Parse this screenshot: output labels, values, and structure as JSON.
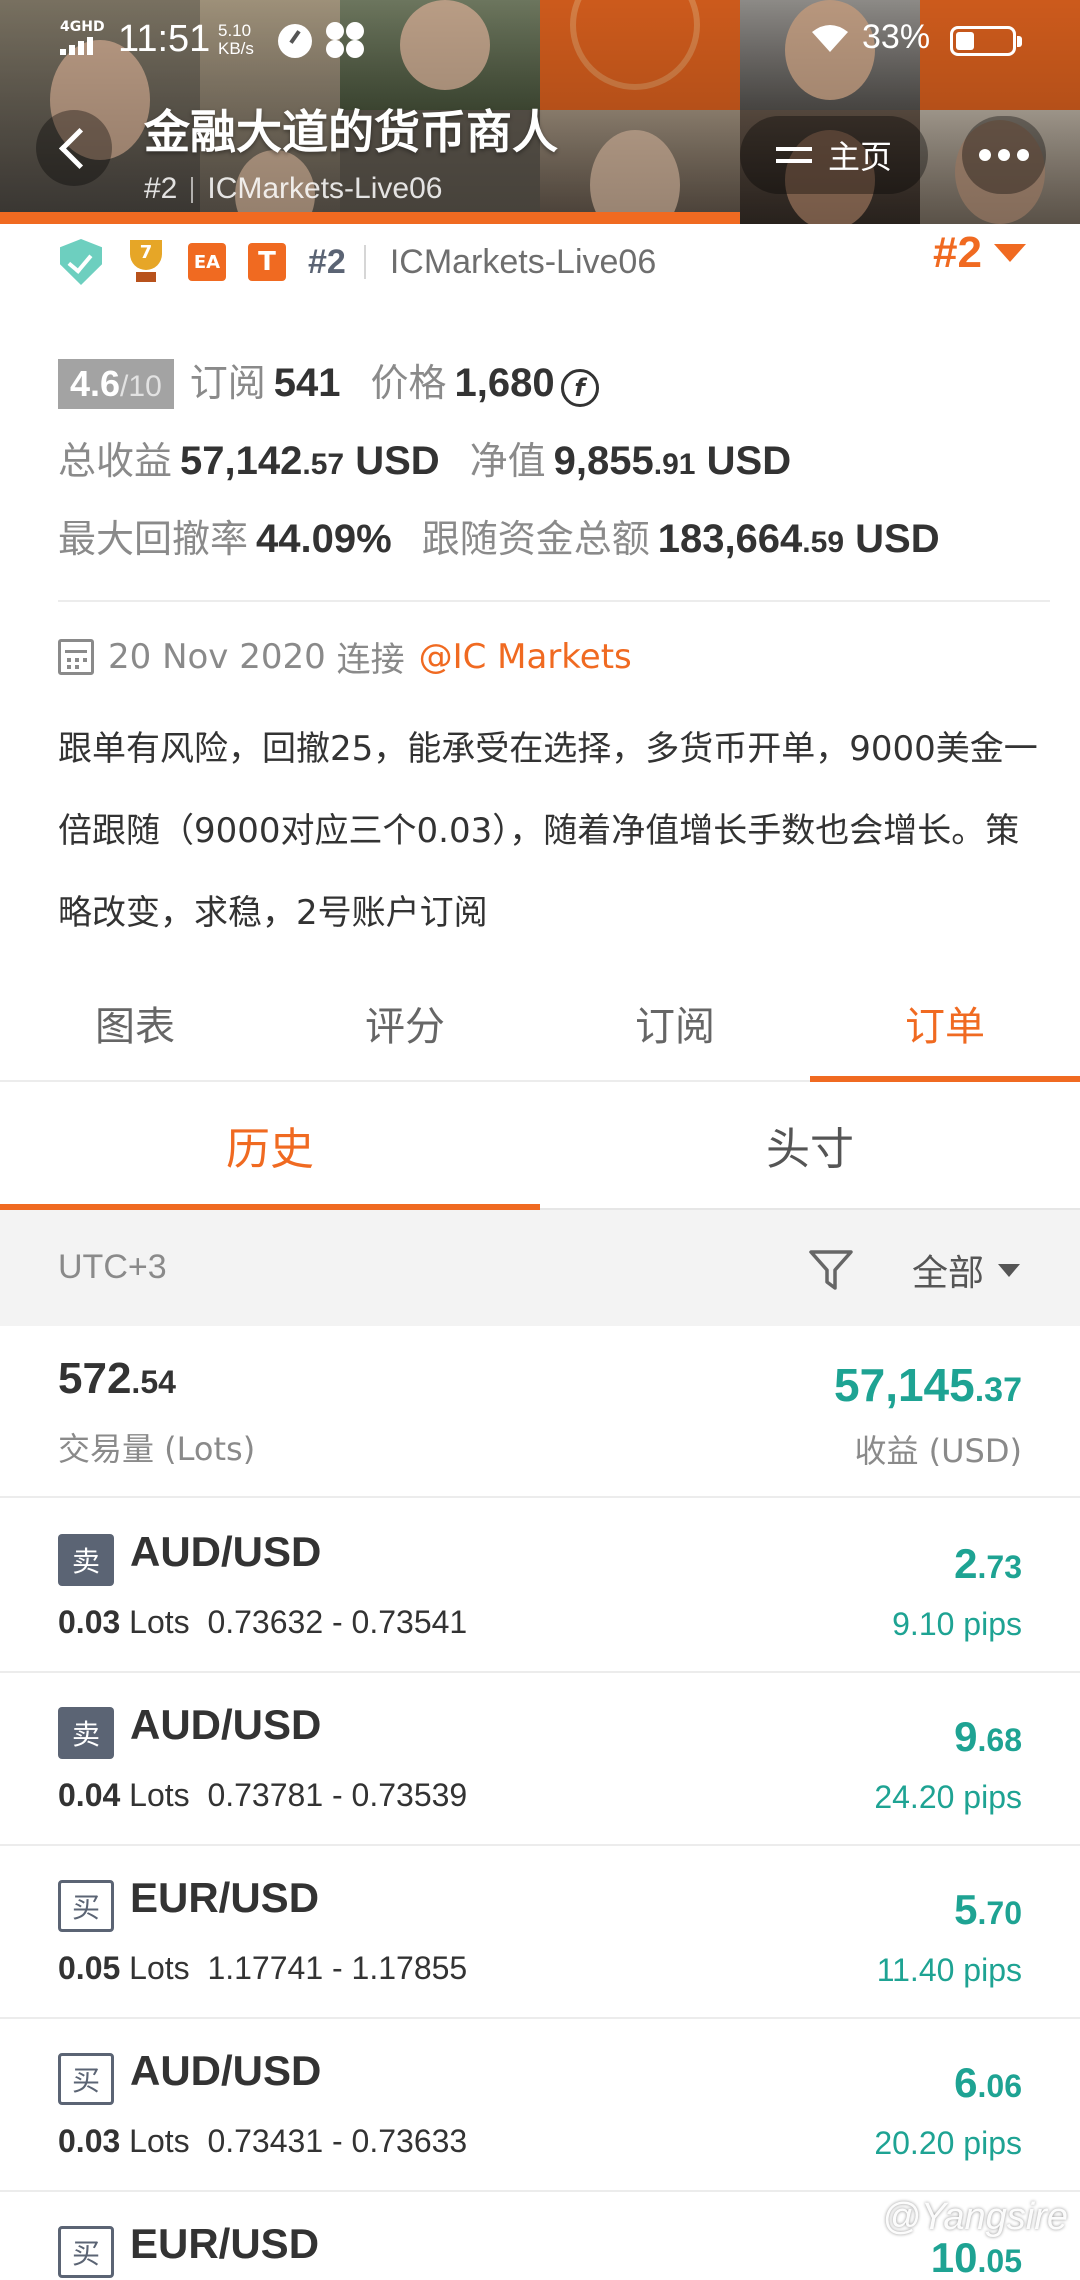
{
  "status_bar": {
    "network": "4GHD",
    "time": "11:51",
    "speed_value": "5.10",
    "speed_unit": "KB/s",
    "battery": "33%"
  },
  "header": {
    "title": "金融大道的货币商人",
    "rank": "#2",
    "server": "ICMarkets-Live06",
    "home_label": "主页"
  },
  "badges": {
    "trophy_number": "7",
    "ea_label": "EA",
    "t_label": "T",
    "rank": "#2",
    "server": "ICMarkets-Live06",
    "rank_right": "#2"
  },
  "stats": {
    "rating": "4.6",
    "rating_denominator": "/10",
    "subscribe_label": "订阅",
    "subscribe_value": "541",
    "price_label": "价格",
    "price_value": "1,680",
    "total_profit_label": "总收益",
    "total_profit_int": "57,142",
    "total_profit_dec": ".57",
    "total_profit_unit": "USD",
    "equity_label": "净值",
    "equity_int": "9,855",
    "equity_dec": ".91",
    "equity_unit": "USD",
    "drawdown_label": "最大回撤率",
    "drawdown_value": "44.09%",
    "follow_label": "跟随资金总额",
    "follow_int": "183,664",
    "follow_dec": ".59",
    "follow_unit": "USD"
  },
  "connection": {
    "date": "20 Nov 2020",
    "connect_label": "连接",
    "broker": "@IC Markets"
  },
  "description": "跟单有风险，回撤25，能承受在选择，多货币开单，9000美金一倍跟随（9000对应三个0.03），随着净值增长手数也会增长。策略改变，求稳，2号账户订阅",
  "tabs": [
    "图表",
    "评分",
    "订阅",
    "订单"
  ],
  "subtabs": [
    "历史",
    "头寸"
  ],
  "filter": {
    "timezone": "UTC+3",
    "dropdown": "全部"
  },
  "summary": {
    "lots_int": "572",
    "lots_dec": ".54",
    "lots_label": "交易量 (Lots)",
    "profit_int": "57,145",
    "profit_dec": ".37",
    "profit_label": "收益 (USD)"
  },
  "trades": [
    {
      "side": "卖",
      "side_type": "sell",
      "pair": "AUD/USD",
      "lots": "0.03",
      "lots_unit": "Lots",
      "range": "0.73632 - 0.73541",
      "profit_int": "2",
      "profit_dec": ".73",
      "pips": "9.10 pips"
    },
    {
      "side": "卖",
      "side_type": "sell",
      "pair": "AUD/USD",
      "lots": "0.04",
      "lots_unit": "Lots",
      "range": "0.73781 - 0.73539",
      "profit_int": "9",
      "profit_dec": ".68",
      "pips": "24.20 pips"
    },
    {
      "side": "买",
      "side_type": "buy",
      "pair": "EUR/USD",
      "lots": "0.05",
      "lots_unit": "Lots",
      "range": "1.17741 - 1.17855",
      "profit_int": "5",
      "profit_dec": ".70",
      "pips": "11.40 pips"
    },
    {
      "side": "买",
      "side_type": "buy",
      "pair": "AUD/USD",
      "lots": "0.03",
      "lots_unit": "Lots",
      "range": "0.73431 - 0.73633",
      "profit_int": "6",
      "profit_dec": ".06",
      "pips": "20.20 pips"
    },
    {
      "side": "买",
      "side_type": "buy",
      "pair": "EUR/USD",
      "lots": "",
      "lots_unit": "",
      "range": "",
      "profit_int": "10",
      "profit_dec": ".05",
      "pips": ""
    }
  ],
  "watermark": "@Yangsire",
  "colors": {
    "accent": "#f06a21",
    "profit": "#1ea393",
    "badge_dark": "#5b6474"
  }
}
